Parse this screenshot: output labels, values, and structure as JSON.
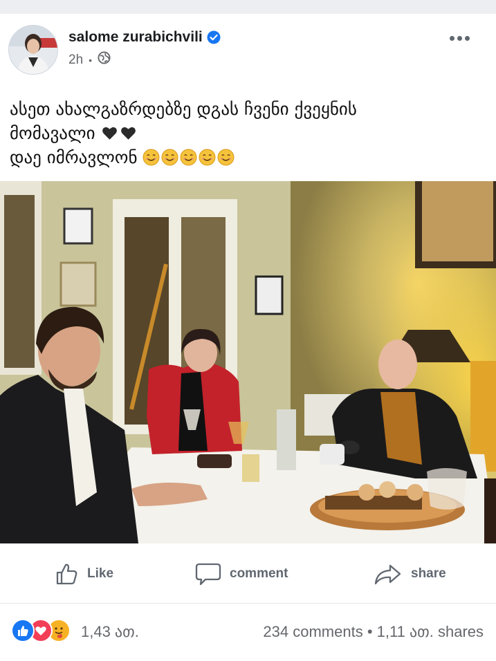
{
  "post": {
    "author": "salome zurabichvili",
    "time": "2h",
    "dot": "•",
    "text_lines": [
      "ასეთ ახალგაზრდებზე დგას ჩვენი ქვეყნის",
      "მომავალი",
      "დაე იმრავლონ"
    ],
    "emoji": {
      "hearts": 2,
      "smileys": 5,
      "heart_color": "#2b2b2b",
      "smiley_color": "#f5c33b"
    }
  },
  "actions": {
    "like": "Like",
    "comment": "comment",
    "share": "share"
  },
  "stats": {
    "reactions_count": "1,43 ათ.",
    "comments": "234 comments",
    "separator": "•",
    "shares": "1,11 ათ. shares"
  },
  "colors": {
    "verified": "#1877f2",
    "like_reaction": "#1877f2",
    "love_reaction": "#f33e58",
    "care_reaction": "#f7b125"
  }
}
